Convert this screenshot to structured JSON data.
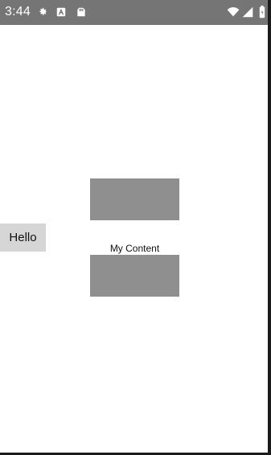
{
  "status_bar": {
    "time": "3:44",
    "icons": [
      "gear-icon",
      "a-badge-icon",
      "sd-card-icon",
      "wifi-icon",
      "signal-icon",
      "battery-icon"
    ],
    "background": "#757575",
    "foreground": "#ffffff"
  },
  "main": {
    "hello_button_label": "Hello",
    "content_label": "My Content",
    "block_color": "#8f8f8f",
    "button_color": "#d6d6d6"
  }
}
